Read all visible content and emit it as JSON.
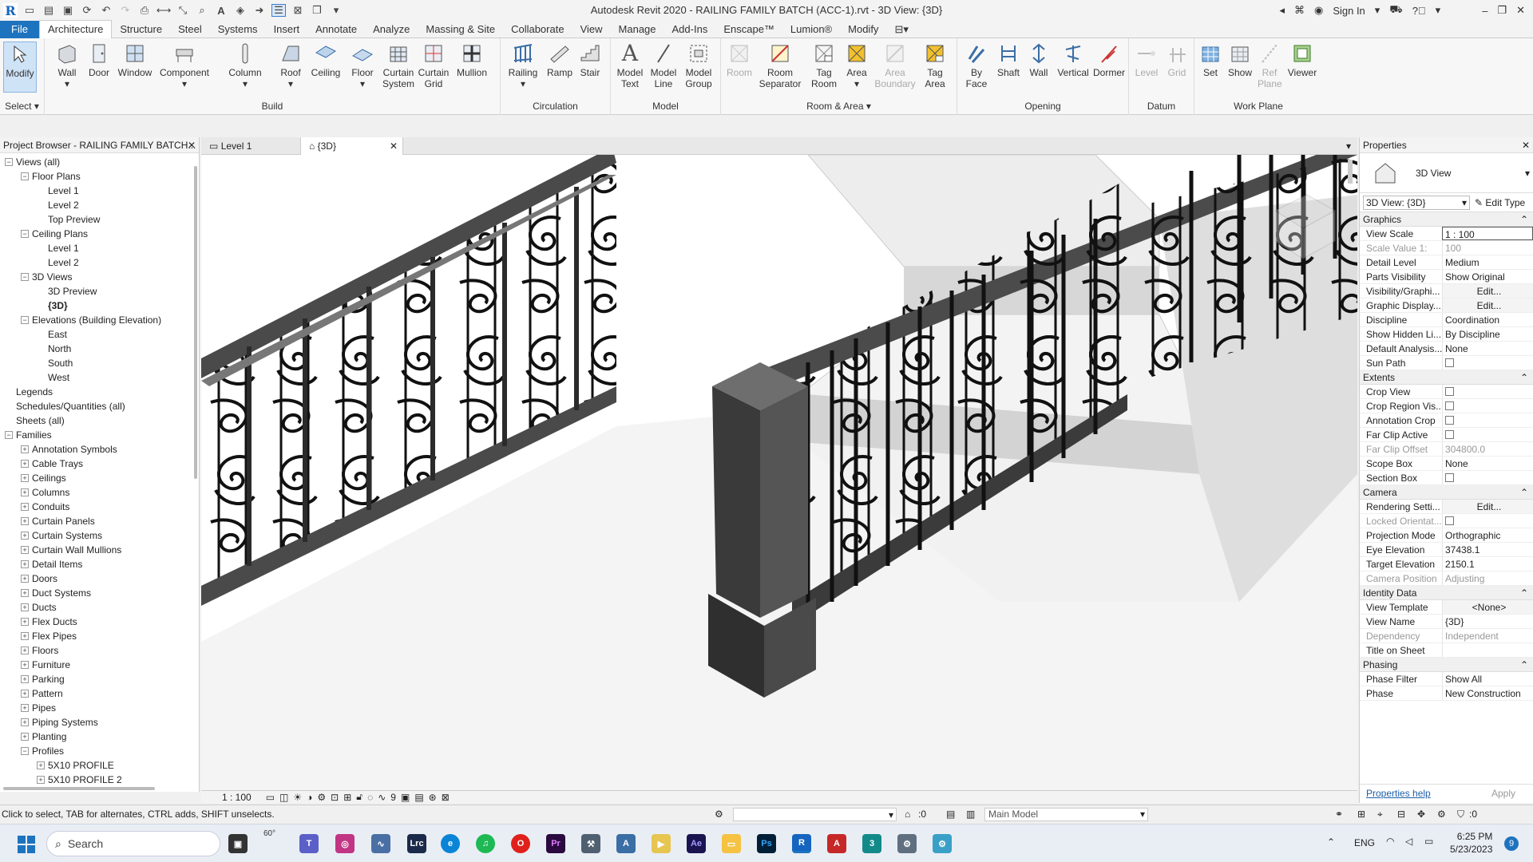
{
  "window": {
    "title": "Autodesk Revit 2020 - RAILING FAMILY BATCH (ACC-1).rvt - 3D View: {3D}",
    "sign_in": "Sign In"
  },
  "ribbon_tabs": [
    "File",
    "Architecture",
    "Structure",
    "Steel",
    "Systems",
    "Insert",
    "Annotate",
    "Analyze",
    "Massing & Site",
    "Collaborate",
    "View",
    "Manage",
    "Add-Ins",
    "Enscape™",
    "Lumion®",
    "Modify"
  ],
  "ribbon": {
    "select_label": "Select",
    "groups": {
      "build": "Build",
      "circulation": "Circulation",
      "model": "Model",
      "room_area": "Room & Area",
      "opening": "Opening",
      "datum": "Datum",
      "work_plane": "Work Plane"
    },
    "buttons": {
      "modify": "Modify",
      "wall": "Wall",
      "door": "Door",
      "window": "Window",
      "component": "Component",
      "column": "Column",
      "roof": "Roof",
      "ceiling": "Ceiling",
      "floor": "Floor",
      "curtain_system": "Curtain System",
      "curtain_grid": "Curtain Grid",
      "mullion": "Mullion",
      "railing": "Railing",
      "ramp": "Ramp",
      "stair": "Stair",
      "model_text": "Model Text",
      "model_line": "Model Line",
      "model_group": "Model Group",
      "room": "Room",
      "room_separator": "Room Separator",
      "tag_room": "Tag Room",
      "area": "Area",
      "area_boundary": "Area Boundary",
      "tag_area": "Tag Area",
      "by_face": "By Face",
      "shaft": "Shaft",
      "wall_op": "Wall",
      "vertical": "Vertical",
      "dormer": "Dormer",
      "level": "Level",
      "grid": "Grid",
      "set": "Set",
      "show": "Show",
      "ref_plane": "Ref Plane",
      "viewer": "Viewer"
    }
  },
  "project_browser": {
    "title": "Project Browser - RAILING FAMILY BATCH...",
    "items": [
      {
        "l": 0,
        "t": "-",
        "label": "Views (all)"
      },
      {
        "l": 1,
        "t": "-",
        "label": "Floor Plans"
      },
      {
        "l": 2,
        "t": "",
        "label": "Level 1"
      },
      {
        "l": 2,
        "t": "",
        "label": "Level 2"
      },
      {
        "l": 2,
        "t": "",
        "label": "Top Preview"
      },
      {
        "l": 1,
        "t": "-",
        "label": "Ceiling Plans"
      },
      {
        "l": 2,
        "t": "",
        "label": "Level 1"
      },
      {
        "l": 2,
        "t": "",
        "label": "Level 2"
      },
      {
        "l": 1,
        "t": "-",
        "label": "3D Views"
      },
      {
        "l": 2,
        "t": "",
        "label": "3D Preview"
      },
      {
        "l": 2,
        "t": "",
        "label": "{3D}",
        "bold": true
      },
      {
        "l": 1,
        "t": "-",
        "label": "Elevations (Building Elevation)"
      },
      {
        "l": 2,
        "t": "",
        "label": "East"
      },
      {
        "l": 2,
        "t": "",
        "label": "North"
      },
      {
        "l": 2,
        "t": "",
        "label": "South"
      },
      {
        "l": 2,
        "t": "",
        "label": "West"
      },
      {
        "l": 0,
        "t": "",
        "label": "Legends"
      },
      {
        "l": 0,
        "t": "",
        "label": "Schedules/Quantities (all)"
      },
      {
        "l": 0,
        "t": "",
        "label": "Sheets (all)"
      },
      {
        "l": 0,
        "t": "-",
        "label": "Families"
      },
      {
        "l": 1,
        "t": "+",
        "label": "Annotation Symbols"
      },
      {
        "l": 1,
        "t": "+",
        "label": "Cable Trays"
      },
      {
        "l": 1,
        "t": "+",
        "label": "Ceilings"
      },
      {
        "l": 1,
        "t": "+",
        "label": "Columns"
      },
      {
        "l": 1,
        "t": "+",
        "label": "Conduits"
      },
      {
        "l": 1,
        "t": "+",
        "label": "Curtain Panels"
      },
      {
        "l": 1,
        "t": "+",
        "label": "Curtain Systems"
      },
      {
        "l": 1,
        "t": "+",
        "label": "Curtain Wall Mullions"
      },
      {
        "l": 1,
        "t": "+",
        "label": "Detail Items"
      },
      {
        "l": 1,
        "t": "+",
        "label": "Doors"
      },
      {
        "l": 1,
        "t": "+",
        "label": "Duct Systems"
      },
      {
        "l": 1,
        "t": "+",
        "label": "Ducts"
      },
      {
        "l": 1,
        "t": "+",
        "label": "Flex Ducts"
      },
      {
        "l": 1,
        "t": "+",
        "label": "Flex Pipes"
      },
      {
        "l": 1,
        "t": "+",
        "label": "Floors"
      },
      {
        "l": 1,
        "t": "+",
        "label": "Furniture"
      },
      {
        "l": 1,
        "t": "+",
        "label": "Parking"
      },
      {
        "l": 1,
        "t": "+",
        "label": "Pattern"
      },
      {
        "l": 1,
        "t": "+",
        "label": "Pipes"
      },
      {
        "l": 1,
        "t": "+",
        "label": "Piping Systems"
      },
      {
        "l": 1,
        "t": "+",
        "label": "Planting"
      },
      {
        "l": 1,
        "t": "-",
        "label": "Profiles"
      },
      {
        "l": 2,
        "t": "+",
        "label": "5X10 PROFILE"
      },
      {
        "l": 2,
        "t": "+",
        "label": "5X10 PROFILE 2"
      }
    ]
  },
  "view_tabs": [
    {
      "label": "Level 1"
    },
    {
      "label": "{3D}"
    }
  ],
  "view_bar": {
    "scale": "1 : 100",
    "crop_count": "9"
  },
  "properties": {
    "title": "Properties",
    "type_name": "3D View",
    "selector": "3D View: {3D}",
    "edit_type": "Edit Type",
    "sections": [
      {
        "name": "Graphics",
        "rows": [
          {
            "k": "View Scale",
            "v": "1 : 100"
          },
          {
            "k": "Scale Value    1:",
            "v": "100",
            "dim": true
          },
          {
            "k": "Detail Level",
            "v": "Medium"
          },
          {
            "k": "Parts Visibility",
            "v": "Show Original"
          },
          {
            "k": "Visibility/Graphi...",
            "v": "Edit...",
            "btn": true
          },
          {
            "k": "Graphic Display...",
            "v": "Edit...",
            "btn": true
          },
          {
            "k": "Discipline",
            "v": "Coordination"
          },
          {
            "k": "Show Hidden Li...",
            "v": "By Discipline"
          },
          {
            "k": "Default Analysis...",
            "v": "None"
          },
          {
            "k": "Sun Path",
            "v": "",
            "cb": true
          }
        ]
      },
      {
        "name": "Extents",
        "rows": [
          {
            "k": "Crop View",
            "v": "",
            "cb": true
          },
          {
            "k": "Crop Region Vis...",
            "v": "",
            "cb": true
          },
          {
            "k": "Annotation Crop",
            "v": "",
            "cb": true
          },
          {
            "k": "Far Clip Active",
            "v": "",
            "cb": true
          },
          {
            "k": "Far Clip Offset",
            "v": "304800.0",
            "dim": true
          },
          {
            "k": "Scope Box",
            "v": "None"
          },
          {
            "k": "Section Box",
            "v": "",
            "cb": true
          }
        ]
      },
      {
        "name": "Camera",
        "rows": [
          {
            "k": "Rendering Setti...",
            "v": "Edit...",
            "btn": true
          },
          {
            "k": "Locked Orientat...",
            "v": "",
            "cb": true,
            "dim": true
          },
          {
            "k": "Projection Mode",
            "v": "Orthographic"
          },
          {
            "k": "Eye Elevation",
            "v": "37438.1"
          },
          {
            "k": "Target Elevation",
            "v": "2150.1"
          },
          {
            "k": "Camera Position",
            "v": "Adjusting",
            "dim": true
          }
        ]
      },
      {
        "name": "Identity Data",
        "rows": [
          {
            "k": "View Template",
            "v": "<None>",
            "btn": true
          },
          {
            "k": "View Name",
            "v": "{3D}"
          },
          {
            "k": "Dependency",
            "v": "Independent",
            "dim": true
          },
          {
            "k": "Title on Sheet",
            "v": ""
          }
        ]
      },
      {
        "name": "Phasing",
        "rows": [
          {
            "k": "Phase Filter",
            "v": "Show All"
          },
          {
            "k": "Phase",
            "v": "New Construction"
          }
        ]
      }
    ],
    "help": "Properties help",
    "apply": "Apply"
  },
  "status": {
    "hint": "Click to select, TAB for alternates, CTRL adds, SHIFT unselects.",
    "worksets": ":0",
    "model": "Main Model",
    "filter": ":0"
  },
  "taskbar": {
    "search": "Search",
    "weather": "60°",
    "lang": "ENG",
    "time": "6:25 PM",
    "date": "5/23/2023",
    "badge": "9"
  }
}
